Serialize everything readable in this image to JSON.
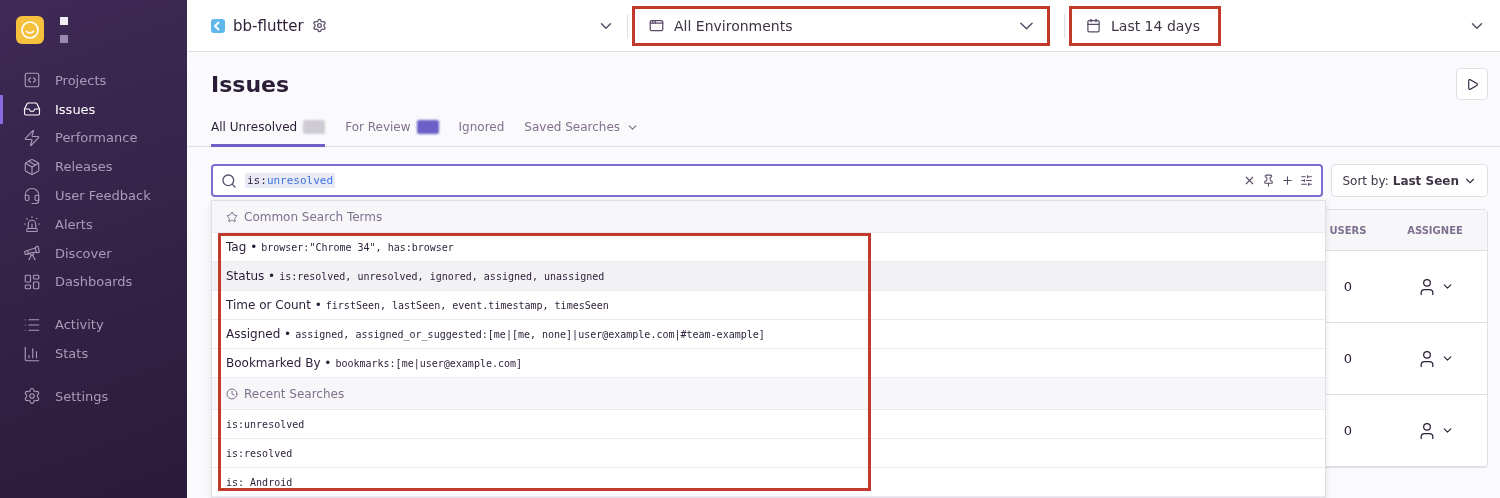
{
  "sidebar": {
    "groups": [
      [
        {
          "label": "Projects",
          "selected": false
        },
        {
          "label": "Issues",
          "selected": true
        },
        {
          "label": "Performance",
          "selected": false
        },
        {
          "label": "Releases",
          "selected": false
        },
        {
          "label": "User Feedback",
          "selected": false
        },
        {
          "label": "Alerts",
          "selected": false
        },
        {
          "label": "Discover",
          "selected": false
        },
        {
          "label": "Dashboards",
          "selected": false
        }
      ],
      [
        {
          "label": "Activity",
          "selected": false
        },
        {
          "label": "Stats",
          "selected": false
        }
      ],
      [
        {
          "label": "Settings",
          "selected": false
        }
      ]
    ]
  },
  "header": {
    "project": "bb-flutter",
    "environment": {
      "label": "All Environments",
      "annotated": true
    },
    "date_range": {
      "label": "Last 14 days",
      "annotated": true
    }
  },
  "page": {
    "title": "Issues",
    "tabs": [
      {
        "label": "All Unresolved",
        "selected": true,
        "redacted_count": true
      },
      {
        "label": "For Review",
        "selected": false,
        "redacted_count": true
      },
      {
        "label": "Ignored",
        "selected": false
      },
      {
        "label": "Saved Searches",
        "selected": false,
        "dropdown": true
      }
    ],
    "search": {
      "key": "is:",
      "value": "unresolved"
    },
    "sort": {
      "label": "Sort by:",
      "value": "Last Seen"
    },
    "table": {
      "columns": [
        "USERS",
        "ASSIGNEE"
      ],
      "rows": [
        {
          "users": "0"
        },
        {
          "users": "0"
        },
        {
          "users": "0"
        }
      ]
    },
    "dropdown": {
      "annotated": true,
      "sections": [
        {
          "kind": "common",
          "title": "Common Search Terms",
          "items": [
            {
              "label": "Tag •",
              "value": "browser:\"Chrome 34\", has:browser",
              "active": false
            },
            {
              "label": "Status •",
              "value": "is:resolved, unresolved, ignored, assigned, unassigned",
              "active": true
            },
            {
              "label": "Time or Count •",
              "value": "firstSeen, lastSeen, event.timestamp, timesSeen",
              "active": false
            },
            {
              "label": "Assigned •",
              "value": "assigned, assigned_or_suggested:[me|[me, none]|user@example.com|#team-example]",
              "active": false
            },
            {
              "label": "Bookmarked By •",
              "value": "bookmarks:[me|user@example.com]",
              "active": false
            }
          ]
        },
        {
          "kind": "recent",
          "title": "Recent Searches",
          "items": [
            {
              "value": "is:unresolved"
            },
            {
              "value": "is:resolved"
            },
            {
              "value": "is: Android"
            }
          ]
        }
      ]
    }
  }
}
